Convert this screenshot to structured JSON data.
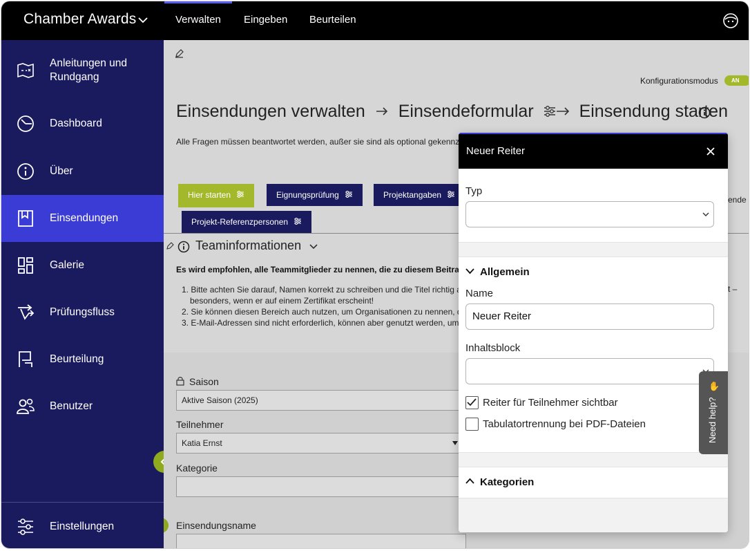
{
  "topbar": {
    "app_title": "Chamber Awards",
    "nav": [
      {
        "label": "Verwalten",
        "active": true
      },
      {
        "label": "Eingeben",
        "active": false
      },
      {
        "label": "Beurteilen",
        "active": false
      }
    ],
    "icons": {
      "app_switch": "chevron-down-icon",
      "user": "user-face-icon"
    }
  },
  "sidebar": {
    "items": [
      {
        "label": "Anleitungen und Rundgang",
        "icon": "map-icon",
        "active": false
      },
      {
        "label": "Dashboard",
        "icon": "dashboard-gauge-icon",
        "active": false
      },
      {
        "label": "Über",
        "icon": "info-icon",
        "active": false
      },
      {
        "label": "Einsendungen",
        "icon": "bookmark-icon",
        "active": true
      },
      {
        "label": "Galerie",
        "icon": "gallery-grid-icon",
        "active": false
      },
      {
        "label": "Prüfungsfluss",
        "icon": "workflow-icon",
        "active": false
      },
      {
        "label": "Beurteilung",
        "icon": "flag-icon",
        "active": false
      },
      {
        "label": "Benutzer",
        "icon": "users-icon",
        "active": false
      }
    ],
    "settings_label": "Einstellungen",
    "settings_icon": "sliders-icon",
    "collapse_icon": "chevron-left-icon"
  },
  "main": {
    "config_label": "Konfigurationsmodus",
    "config_toggle": "AN",
    "breadcrumb": [
      "Einsendungen verwalten",
      "Einsendeformular",
      "Einsendung starten"
    ],
    "instructions": "Alle Fragen müssen beantwortet werden, außer sie sind als optional gekennz",
    "tabs": [
      {
        "label": "Hier starten"
      },
      {
        "label": "Eignungsprüfung"
      },
      {
        "label": "Projektangaben"
      },
      {
        "label": "Projekt-Referenzpersonen"
      }
    ],
    "tabs_right_text": "ende",
    "section_title": "Teaminformationen",
    "recommendation": "Es wird empfohlen, alle Teammitglieder zu nennen, die zu diesem Beitra",
    "tips": [
      "1. Bitte achten Sie darauf, Namen korrekt zu schreiben und die Titel richtig a",
      "besonders, wenn er auf einem Zertifikat erscheint!",
      "2. Sie können diesen Bereich auch nutzen, um Organisationen zu nennen, d",
      "3. E-Mail-Adressen sind nicht erforderlich, können aber genutzt werden, um"
    ],
    "tips_right": "t –",
    "form": {
      "season_label": "Saison",
      "season_value": "Aktive Saison (2025)",
      "participant_label": "Teilnehmer",
      "participant_value": "Katia Ernst",
      "category_label": "Kategorie",
      "category_value": "",
      "entry_name_label": "Einsendungsname",
      "entry_name_value": ""
    }
  },
  "modal": {
    "title": "Neuer Reiter",
    "type_label": "Typ",
    "type_value": "",
    "general_section": "Allgemein",
    "name_label": "Name",
    "name_value": "Neuer Reiter",
    "content_block_label": "Inhaltsblock",
    "content_block_value": "",
    "visible_checkbox_label": "Reiter für Teilnehmer sichtbar",
    "visible_checked": true,
    "pdf_checkbox_label": "Tabulatortrennung bei PDF-Dateien",
    "pdf_checked": false,
    "categories_section": "Kategorien"
  },
  "help": {
    "label": "Need help?",
    "icon": "waving-hand-icon"
  },
  "colors": {
    "sidebar_bg": "#1a1a5e",
    "sidebar_active": "#3b3bd6",
    "accent_green": "#a3b82a",
    "topbar_bg": "#000000"
  }
}
